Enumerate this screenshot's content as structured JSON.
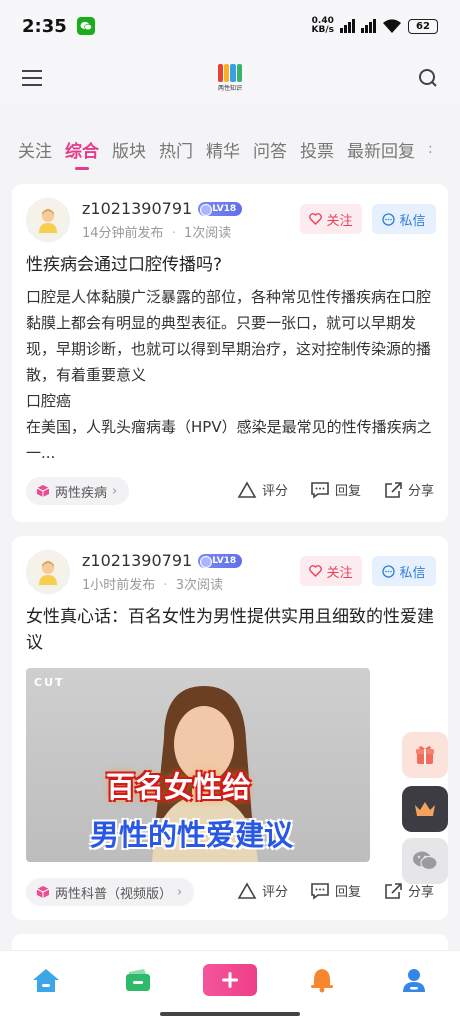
{
  "status_bar": {
    "time": "2:35",
    "net_speed_value": "0.40",
    "net_speed_unit": "KB/s",
    "battery": "62"
  },
  "header": {
    "logo_text": "两性知识"
  },
  "tabs": [
    {
      "label": "关注",
      "active": false
    },
    {
      "label": "综合",
      "active": true
    },
    {
      "label": "版块",
      "active": false
    },
    {
      "label": "热门",
      "active": false
    },
    {
      "label": "精华",
      "active": false
    },
    {
      "label": "问答",
      "active": false
    },
    {
      "label": "投票",
      "active": false
    },
    {
      "label": "最新回复",
      "active": false
    }
  ],
  "posts": [
    {
      "author": "z1021390791",
      "level": "LV18",
      "time": "14分钟前发布",
      "views": "1次阅读",
      "follow_label": "关注",
      "message_label": "私信",
      "title": "性疾病会通过口腔传播吗?",
      "body": [
        "口腔是人体黏膜广泛暴露的部位，各种常见性传播疾病在口腔黏膜上都会有明显的典型表征。只要一张口，就可以早期发现，早期诊断，也就可以得到早期治疗，这对控制传染源的播散，有着重要意义",
        "口腔癌",
        "在美国，人乳头瘤病毒（HPV）感染是最常见的性传播疾病之一..."
      ],
      "tag": "两性疾病",
      "actions": {
        "rate": "评分",
        "reply": "回复",
        "share": "分享"
      }
    },
    {
      "author": "z1021390791",
      "level": "LV18",
      "time": "1小时前发布",
      "views": "3次阅读",
      "follow_label": "关注",
      "message_label": "私信",
      "title": "女性真心话：百名女性为男性提供实用且细致的性爱建议",
      "video": {
        "corner_label": "CUT",
        "caption_line1": "百名女性给",
        "caption_line2": "男性的性爱建议"
      },
      "tag": "两性科普（视频版）",
      "actions": {
        "rate": "评分",
        "reply": "回复",
        "share": "分享"
      }
    }
  ],
  "colors": {
    "accent": "#e6398b",
    "follow": "#ef3e5c",
    "message": "#2f7ed8",
    "nav_home": "#3da6e8",
    "nav_wallet": "#2dbb6b",
    "nav_bell": "#f6872f",
    "nav_user": "#3487e6"
  }
}
